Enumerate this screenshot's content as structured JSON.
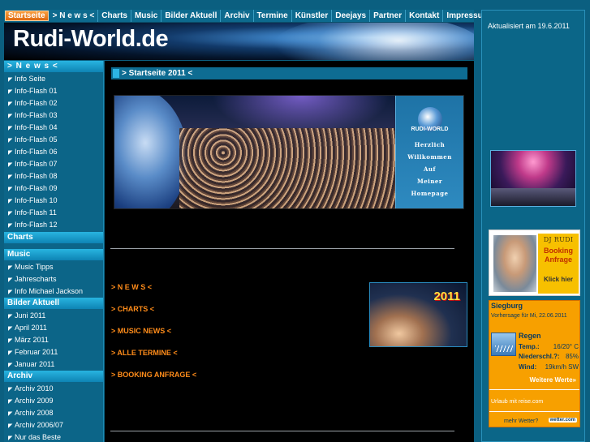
{
  "nav": {
    "items": [
      "Startseite",
      "> N e w s <",
      "Charts",
      "Music",
      "Bilder Aktuell",
      "Archiv",
      "Termine",
      "Künstler",
      "Deejays",
      "Partner",
      "Kontakt",
      "Impressum"
    ]
  },
  "banner": {
    "logo": "Rudi-World.de"
  },
  "sidebar": {
    "news_head": "> N e w s <",
    "news_items": [
      "Info Seite",
      "Info-Flash 01",
      "Info-Flash 02",
      "Info-Flash 03",
      "Info-Flash 04",
      "Info-Flash 05",
      "Info-Flash 06",
      "Info-Flash 07",
      "Info-Flash 08",
      "Info-Flash 09",
      "Info-Flash 10",
      "Info-Flash 11",
      "Info-Flash 12"
    ],
    "charts_head": "Charts",
    "music_head": "Music",
    "music_items": [
      "Music Tipps",
      "Jahrescharts",
      "Info Michael Jackson"
    ],
    "bilder_head": "Bilder Aktuell",
    "bilder_items": [
      "Juni 2011",
      "April 2011",
      "März 2011",
      "Februar 2011",
      "Januar 2011"
    ],
    "archiv_head": "Archiv",
    "archiv_items": [
      "Archiv 2010",
      "Archiv 2009",
      "Archiv 2008",
      "Archiv 2006/07",
      "Nur das Beste"
    ],
    "arrow": "◤"
  },
  "main": {
    "title": "> Startseite 2011 <",
    "hero": {
      "brand": "RUDI-WORLD",
      "welcome_lines": [
        "Herzlich",
        "Willkommen",
        "Auf",
        "Meiner",
        "Homepage"
      ]
    },
    "links": [
      "> N E W S <",
      "> CHARTS <",
      "> MUSIC NEWS <",
      "> ALLE TERMINE <",
      "> BOOKING ANFRAGE <"
    ],
    "thumb_year": "2011"
  },
  "right": {
    "updated": "Aktualisiert am 19.6.2011",
    "booking": {
      "dj": "DJ RUDI",
      "line1": "Booking",
      "line2": "Anfrage",
      "cta": "Klick hier"
    },
    "weather": {
      "city": "Siegburg",
      "forecast": "Vorhersage für Mi, 22.06.2011",
      "condition": "Regen",
      "temp_label": "Temp.:",
      "temp_value": "16/20° C",
      "rain_label": "Niederschl.?:",
      "rain_value": "85%",
      "wind_label": "Wind:",
      "wind_value": "19km/h SW",
      "more": "Weitere Werte»",
      "urlaub": "Urlaub mit reise.com",
      "mehr": "mehr Wetter?",
      "logo": "wetter.com"
    }
  }
}
